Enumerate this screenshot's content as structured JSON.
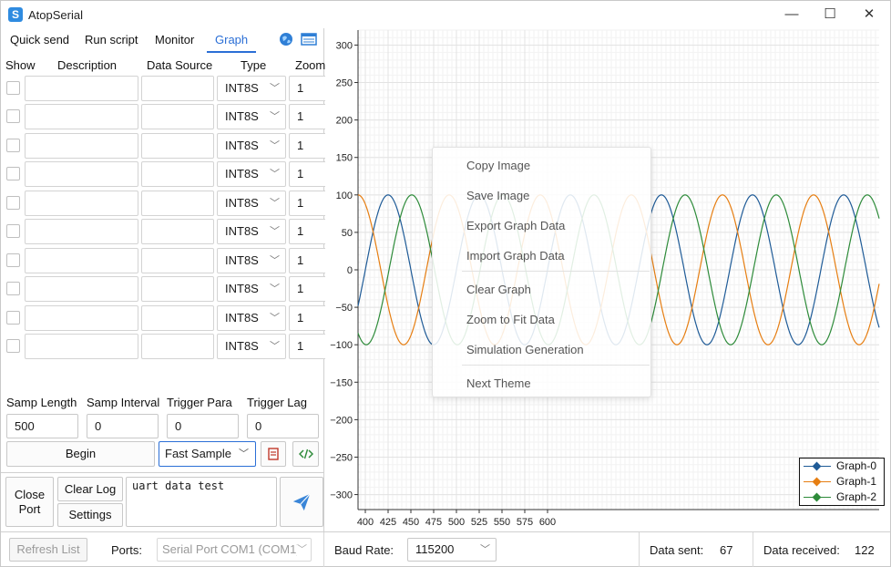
{
  "app": {
    "title": "AtopSerial",
    "icon_text": "S"
  },
  "window_controls": {
    "minimize": "—",
    "maximize": "☐",
    "close": "✕"
  },
  "tabs": [
    {
      "label": "Quick send"
    },
    {
      "label": "Run script"
    },
    {
      "label": "Monitor"
    },
    {
      "label": "Graph"
    }
  ],
  "grid": {
    "headers": {
      "show": "Show",
      "description": "Description",
      "data_source": "Data Source",
      "type": "Type",
      "zoom": "Zoom"
    },
    "rows": [
      {
        "type": "INT8S",
        "zoom": "1"
      },
      {
        "type": "INT8S",
        "zoom": "1"
      },
      {
        "type": "INT8S",
        "zoom": "1"
      },
      {
        "type": "INT8S",
        "zoom": "1"
      },
      {
        "type": "INT8S",
        "zoom": "1"
      },
      {
        "type": "INT8S",
        "zoom": "1"
      },
      {
        "type": "INT8S",
        "zoom": "1"
      },
      {
        "type": "INT8S",
        "zoom": "1"
      },
      {
        "type": "INT8S",
        "zoom": "1"
      },
      {
        "type": "INT8S",
        "zoom": "1"
      }
    ]
  },
  "sampling": {
    "samp_length_label": "Samp Length",
    "samp_length": "500",
    "samp_interval_label": "Samp Interval",
    "samp_interval": "0",
    "trigger_para_label": "Trigger Para",
    "trigger_para": "0",
    "trigger_lag_label": "Trigger Lag",
    "trigger_lag": "0",
    "begin": "Begin",
    "mode": "Fast Sample"
  },
  "send": {
    "close_port": "Close Port",
    "clear_log": "Clear Log",
    "settings": "Settings",
    "text": "uart data test"
  },
  "status": {
    "refresh": "Refresh List",
    "ports_label": "Ports:",
    "port_value": "Serial Port COM1 (COM1)",
    "baud_label": "Baud Rate:",
    "baud_value": "115200",
    "sent_label": "Data sent:",
    "sent_value": "67",
    "recv_label": "Data received:",
    "recv_value": "122"
  },
  "context_menu": {
    "items": [
      "Copy Image",
      "Save Image",
      "Export Graph Data",
      "Import Graph Data",
      "Clear Graph",
      "Zoom to Fit Data",
      "Simulation Generation",
      "Next Theme"
    ]
  },
  "colors": {
    "accent": "#2b6fd6",
    "graph0": "#1f5b97",
    "graph1": "#e67e12",
    "graph2": "#2e8b3a"
  },
  "chart_data": {
    "type": "line",
    "xlim": [
      392,
      964
    ],
    "ylim": [
      -320,
      320
    ],
    "x_ticks": [
      400,
      425,
      450,
      475,
      500,
      525,
      550,
      575,
      600
    ],
    "y_ticks": [
      300,
      250,
      200,
      150,
      100,
      50,
      0,
      -50,
      -100,
      -150,
      -200,
      -250,
      -300
    ],
    "x_tick_labels": [
      "400",
      "425",
      "450",
      "475",
      "500",
      "525",
      "550",
      "575",
      "600"
    ],
    "y_tick_labels": [
      "300",
      "250",
      "200",
      "150",
      "100",
      "50",
      "0",
      "−50",
      "−100",
      "−150",
      "−200",
      "−250",
      "−300"
    ],
    "grid": true,
    "legend_position": "bottom-right",
    "series": [
      {
        "name": "Graph-0",
        "color": "#1f5b97",
        "amplitude": 100,
        "period": 100,
        "phase_deg": -1,
        "x_start": 392,
        "x_end": 614
      },
      {
        "name": "Graph-1",
        "color": "#e67e12",
        "amplitude": 100,
        "period": 100,
        "phase_deg": 1,
        "x_start": 392,
        "x_end": 614
      },
      {
        "name": "Graph-2",
        "color": "#2e8b3a",
        "amplitude": 100,
        "period": 100,
        "phase_deg": 0,
        "x_start": 392,
        "x_end": 614
      }
    ]
  }
}
